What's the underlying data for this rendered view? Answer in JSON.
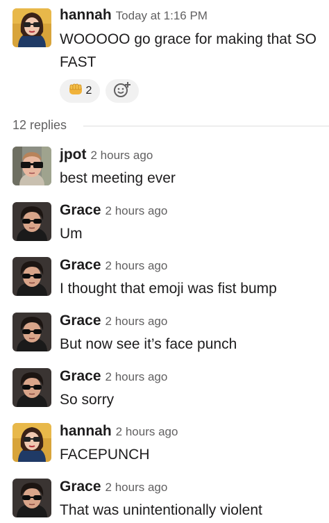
{
  "parent": {
    "author": "hannah",
    "timestamp": "Today at 1:16 PM",
    "text": "WOOOOO go grace for making that SO FAST",
    "reactions": [
      {
        "emoji": "fist-bump",
        "count": "2"
      },
      {
        "emoji": "add-reaction"
      }
    ]
  },
  "thread": {
    "replies_label": "12 replies"
  },
  "replies": [
    {
      "author": "jpot",
      "timestamp": "2 hours ago",
      "text": "best meeting ever",
      "avatar": "jpot"
    },
    {
      "author": "Grace",
      "timestamp": "2 hours ago",
      "text": "Um",
      "avatar": "grace"
    },
    {
      "author": "Grace",
      "timestamp": "2 hours ago",
      "text": "I thought that emoji was fist bump",
      "avatar": "grace"
    },
    {
      "author": "Grace",
      "timestamp": "2 hours ago",
      "text": "But now see it’s face punch",
      "avatar": "grace"
    },
    {
      "author": "Grace",
      "timestamp": "2 hours ago",
      "text": "So sorry",
      "avatar": "grace"
    },
    {
      "author": "hannah",
      "timestamp": "2 hours ago",
      "text": "FACEPUNCH",
      "avatar": "hannah"
    },
    {
      "author": "Grace",
      "timestamp": "2 hours ago",
      "text": "That was unintentionally violent",
      "avatar": "grace"
    }
  ]
}
